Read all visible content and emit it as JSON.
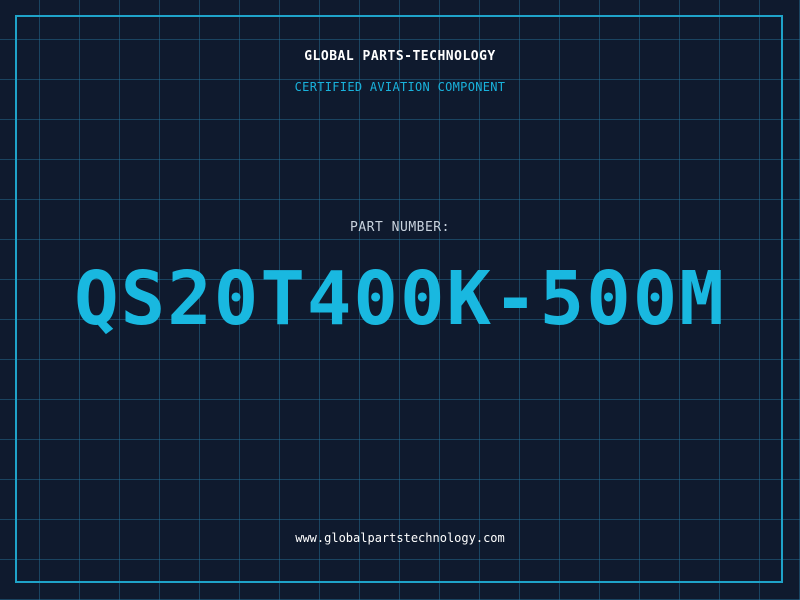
{
  "header": {
    "company": "GLOBAL PARTS-TECHNOLOGY",
    "tagline": "CERTIFIED AVIATION COMPONENT"
  },
  "main": {
    "label": "PART NUMBER:",
    "part_number": "QS20T400K-500M"
  },
  "footer": {
    "url": "www.globalpartstechnology.com"
  },
  "colors": {
    "background": "#0f1a2e",
    "grid": "#2878a0",
    "accent": "#19b8e0",
    "text": "#ffffff"
  }
}
